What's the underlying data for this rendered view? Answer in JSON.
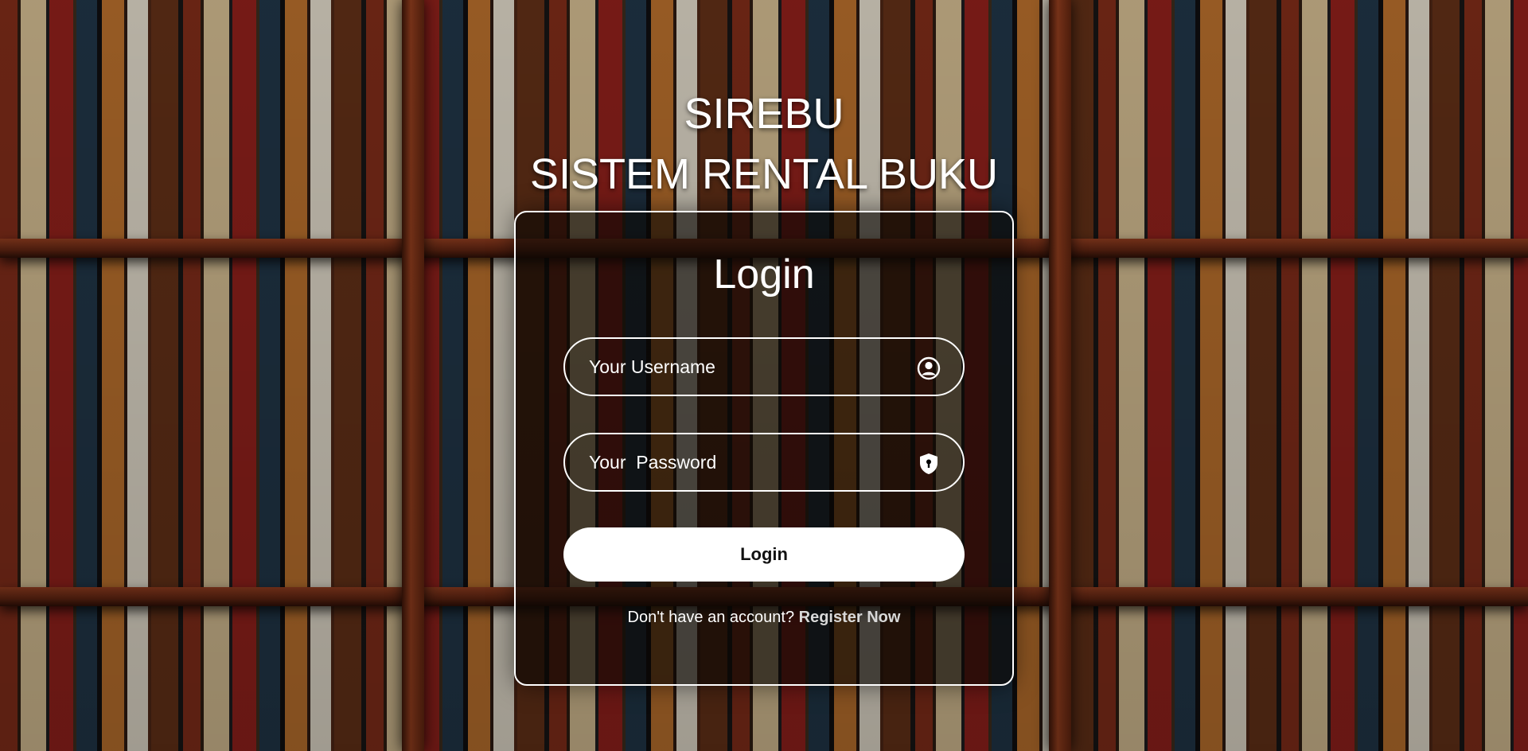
{
  "header": {
    "title_short": "SIREBU",
    "title_long": "SISTEM RENTAL BUKU"
  },
  "login": {
    "title": "Login",
    "username_placeholder": "Your Username",
    "username_icon": "user-circle-icon",
    "password_placeholder": "Your  Password",
    "password_icon": "shield-lock-icon",
    "submit_label": "Login",
    "register_prompt": "Don't have an account?",
    "register_link": "Register Now"
  },
  "colors": {
    "text": "#ffffff",
    "button_bg": "#ffffff",
    "button_text": "#111111",
    "link": "#d8d8d8"
  }
}
